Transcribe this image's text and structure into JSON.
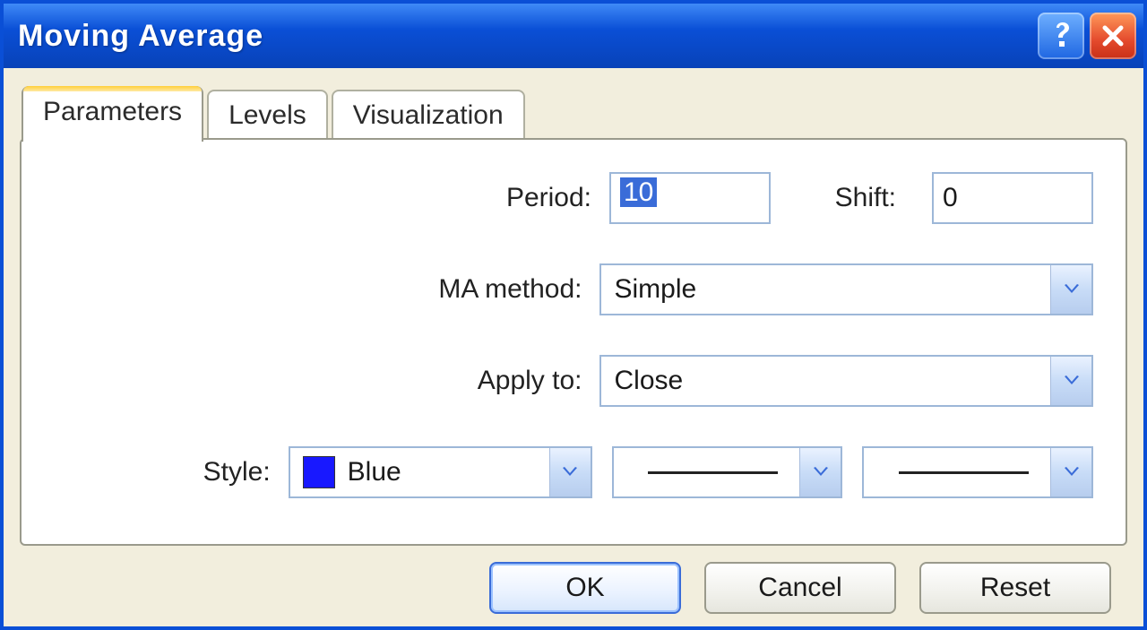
{
  "window": {
    "title": "Moving Average"
  },
  "tabs": {
    "parameters": "Parameters",
    "levels": "Levels",
    "visualization": "Visualization"
  },
  "labels": {
    "period": "Period:",
    "shift": "Shift:",
    "ma_method": "MA method:",
    "apply_to": "Apply to:",
    "style": "Style:"
  },
  "values": {
    "period": "10",
    "shift": "0",
    "ma_method": "Simple",
    "apply_to": "Close",
    "color_name": "Blue",
    "color_hex": "#1818ff"
  },
  "buttons": {
    "ok": "OK",
    "cancel": "Cancel",
    "reset": "Reset"
  }
}
